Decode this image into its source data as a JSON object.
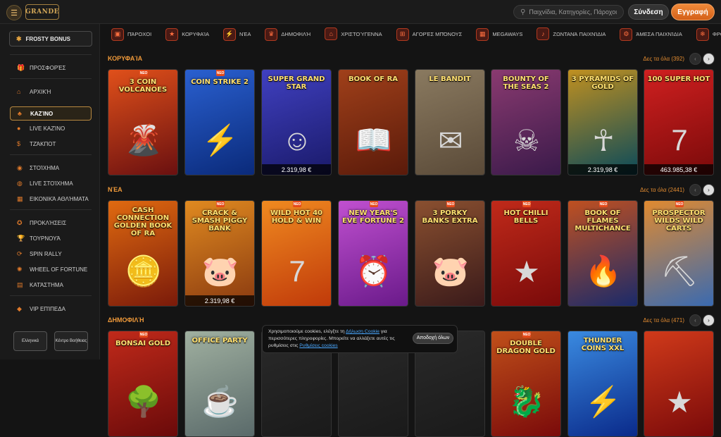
{
  "header": {
    "logo_text": "GRANDE",
    "search_placeholder": "Παιχνίδια, Κατηγορίες, Πάροχοι",
    "login_label": "Σύνδεση",
    "register_label": "Εγγραφή"
  },
  "sidebar": {
    "bonus_label": "FROSTY BONUS",
    "items": [
      {
        "label": "Προσφορές",
        "icon": "gift-icon"
      },
      {
        "label": "Αρχική",
        "icon": "home-icon"
      },
      {
        "label": "Καζίνο",
        "icon": "casino-icon"
      },
      {
        "label": "Live Καζίνο",
        "icon": "live-casino-icon"
      },
      {
        "label": "Τζάκποτ",
        "icon": "jackpot-icon"
      },
      {
        "label": "Στοίχημα",
        "icon": "ball-icon"
      },
      {
        "label": "Live Στοίχημα",
        "icon": "live-bet-icon"
      },
      {
        "label": "Εικονικά Αθλήματα",
        "icon": "virtual-icon"
      },
      {
        "label": "Προκλήσεις",
        "icon": "challenge-icon"
      },
      {
        "label": "Τουρνουά",
        "icon": "tournament-icon"
      },
      {
        "label": "Spin Rally",
        "icon": "spin-icon"
      },
      {
        "label": "Wheel of Fortune",
        "icon": "wheel-icon"
      },
      {
        "label": "Κατάστημα",
        "icon": "shop-icon"
      },
      {
        "label": "VIP Επίπεδα",
        "icon": "diamond-icon"
      }
    ],
    "language_label": "Ελληνικά",
    "help_label": "Κέντρο Βοήθειας"
  },
  "categories": [
    {
      "label": "Πάροχοι"
    },
    {
      "label": "Κορυφαία"
    },
    {
      "label": "Νέα"
    },
    {
      "label": "Δημοφιλή"
    },
    {
      "label": "Χριστούγεννα"
    },
    {
      "label": "Αγορές Μπόνους"
    },
    {
      "label": "Megaways"
    },
    {
      "label": "Ζωντανά Παιχνίδια"
    },
    {
      "label": "Άμεσα Παιχνίδια"
    },
    {
      "label": "Φρο"
    }
  ],
  "sections": [
    {
      "title": "Κορυφαία",
      "see_all": "Δες τα όλα (392)",
      "games": [
        {
          "name": "3 COIN VOLCANOES",
          "badge": "ΝΕΟ",
          "jackpot": "",
          "c1": "#6a1010",
          "c2": "#e0501a"
        },
        {
          "name": "COIN STRIKE 2",
          "badge": "ΝΕΟ",
          "jackpot": "",
          "c1": "#0a2a7a",
          "c2": "#2a60d0"
        },
        {
          "name": "SUPER GRAND STAR",
          "badge": "",
          "jackpot": "2.319,98 €",
          "c1": "#1a1a6a",
          "c2": "#4040c0"
        },
        {
          "name": "BOOK OF RA",
          "badge": "",
          "jackpot": "",
          "c1": "#5a1a0a",
          "c2": "#a0401a"
        },
        {
          "name": "LE BANDIT",
          "badge": "",
          "jackpot": "",
          "c1": "#5a4a38",
          "c2": "#8a7a60"
        },
        {
          "name": "BOUNTY OF THE SEAS 2",
          "badge": "",
          "jackpot": "",
          "c1": "#3a1a4a",
          "c2": "#8a3a70"
        },
        {
          "name": "3 PYRAMIDS OF GOLD",
          "badge": "",
          "jackpot": "2.319,98 €",
          "c1": "#0a4a5a",
          "c2": "#c09020"
        },
        {
          "name": "100 SUPER HOT",
          "badge": "",
          "jackpot": "463.985,38 €",
          "c1": "#7a0a0a",
          "c2": "#d02020"
        }
      ]
    },
    {
      "title": "Νέα",
      "see_all": "Δες τα όλα (2441)",
      "games": [
        {
          "name": "CASH CONNECTION GOLDEN BOOK OF RA",
          "badge": "",
          "jackpot": "",
          "c1": "#7a1a0a",
          "c2": "#e06a10"
        },
        {
          "name": "CRACK & SMASH PIGGY BANK",
          "badge": "ΝΕΟ",
          "jackpot": "2.319,98 €",
          "c1": "#8a3a10",
          "c2": "#e08a20"
        },
        {
          "name": "WILD HOT 40 HOLD & WIN",
          "badge": "ΝΕΟ",
          "jackpot": "",
          "c1": "#c03a0a",
          "c2": "#f08a20"
        },
        {
          "name": "NEW YEAR'S EVE FORTUNE 2",
          "badge": "ΝΕΟ",
          "jackpot": "",
          "c1": "#6a1a8a",
          "c2": "#c050d0"
        },
        {
          "name": "3 PORKY BANKS EXTRA",
          "badge": "ΝΕΟ",
          "jackpot": "",
          "c1": "#3a1a1a",
          "c2": "#8a5030"
        },
        {
          "name": "HOT CHILLI BELLS",
          "badge": "ΝΕΟ",
          "jackpot": "",
          "c1": "#7a0a0a",
          "c2": "#c02a1a"
        },
        {
          "name": "BOOK OF FLAMES MULTICHANCE",
          "badge": "ΝΕΟ",
          "jackpot": "",
          "c1": "#1a2a6a",
          "c2": "#c05020"
        },
        {
          "name": "PROSPECTOR WILDS WILD CARTS",
          "badge": "ΝΕΟ",
          "jackpot": "",
          "c1": "#3a6ab0",
          "c2": "#e08a30"
        }
      ]
    },
    {
      "title": "Δημοφιλή",
      "see_all": "Δες τα όλα (471)",
      "games": [
        {
          "name": "BONSAI GOLD",
          "badge": "ΝΕΟ",
          "jackpot": "",
          "c1": "#6a0a0a",
          "c2": "#c02a1a"
        },
        {
          "name": "OFFICE PARTY",
          "badge": "",
          "jackpot": "",
          "c1": "#5a6a6a",
          "c2": "#a0b0a0"
        },
        {
          "name": "",
          "badge": "",
          "jackpot": "",
          "c1": "#1a1a1a",
          "c2": "#2a2a2a"
        },
        {
          "name": "",
          "badge": "",
          "jackpot": "",
          "c1": "#1a1a1a",
          "c2": "#2a2a2a"
        },
        {
          "name": "",
          "badge": "",
          "jackpot": "",
          "c1": "#1a1a1a",
          "c2": "#2a2a2a"
        },
        {
          "name": "DOUBLE DRAGON GOLD",
          "badge": "ΝΕΟ",
          "jackpot": "",
          "c1": "#7a0a0a",
          "c2": "#c0501a"
        },
        {
          "name": "THUNDER COINS XXL",
          "badge": "",
          "jackpot": "",
          "c1": "#0a2a8a",
          "c2": "#3a8ae0"
        },
        {
          "name": "",
          "badge": "",
          "jackpot": "",
          "c1": "#7a0a0a",
          "c2": "#d03a1a"
        }
      ]
    }
  ],
  "cookie": {
    "text_before": "Χρησιμοποιούμε cookies, ελέγξτε τη ",
    "policy_link": "Δήλωση Cookie",
    "text_middle": " για περισσότερες πληροφορίες. Μπορείτε να αλλάξετε αυτές τις ρυθμίσεις στις ",
    "settings_link": "Ρυθμίσεις cookies",
    "accept_label": "Αποδοχή όλων"
  }
}
